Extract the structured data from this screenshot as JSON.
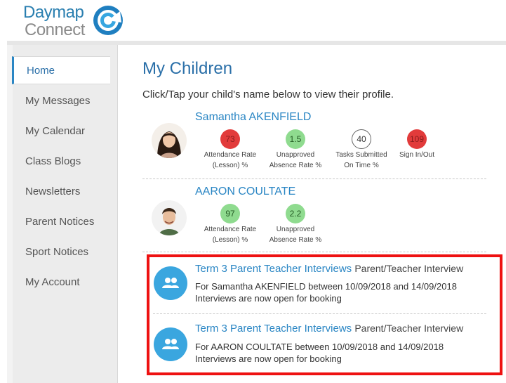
{
  "brand": {
    "line1": "Daymap",
    "line2": "Connect"
  },
  "sidebar": {
    "items": [
      {
        "label": "Home",
        "active": true
      },
      {
        "label": "My Messages"
      },
      {
        "label": "My Calendar"
      },
      {
        "label": "Class Blogs"
      },
      {
        "label": "Newsletters"
      },
      {
        "label": "Parent Notices"
      },
      {
        "label": "Sport Notices"
      },
      {
        "label": "My Account"
      }
    ]
  },
  "main": {
    "title": "My Children",
    "subtitle": "Click/Tap your child's name below to view their profile."
  },
  "children": [
    {
      "name": "Samantha AKENFIELD",
      "metrics": [
        {
          "value": "73",
          "label1": "Attendance Rate",
          "label2": "(Lesson) %",
          "color": "red"
        },
        {
          "value": "1.5",
          "label1": "Unapproved",
          "label2": "Absence Rate %",
          "color": "green"
        },
        {
          "value": "40",
          "label1": "Tasks Submitted",
          "label2": "On Time %",
          "color": "white"
        },
        {
          "value": "109",
          "label1": "Sign In/Out",
          "label2": "",
          "color": "red"
        }
      ]
    },
    {
      "name": "AARON COULTATE",
      "metrics": [
        {
          "value": "97",
          "label1": "Attendance Rate",
          "label2": "(Lesson) %",
          "color": "green"
        },
        {
          "value": "2.2",
          "label1": "Unapproved",
          "label2": "Absence Rate %",
          "color": "green"
        }
      ]
    }
  ],
  "notices": [
    {
      "title": "Term 3 Parent Teacher Interviews",
      "type": "Parent/Teacher Interview",
      "line1": "For Samantha AKENFIELD between 10/09/2018 and 14/09/2018",
      "line2": "Interviews are now open for booking"
    },
    {
      "title": "Term 3 Parent Teacher Interviews",
      "type": "Parent/Teacher Interview",
      "line1": "For AARON COULTATE between 10/09/2018 and 14/09/2018",
      "line2": "Interviews are now open for booking"
    }
  ],
  "colors": {
    "accent": "#2a86c4",
    "highlight": "#ee1111",
    "red": "#e23b3b",
    "green": "#8fdb8f"
  }
}
